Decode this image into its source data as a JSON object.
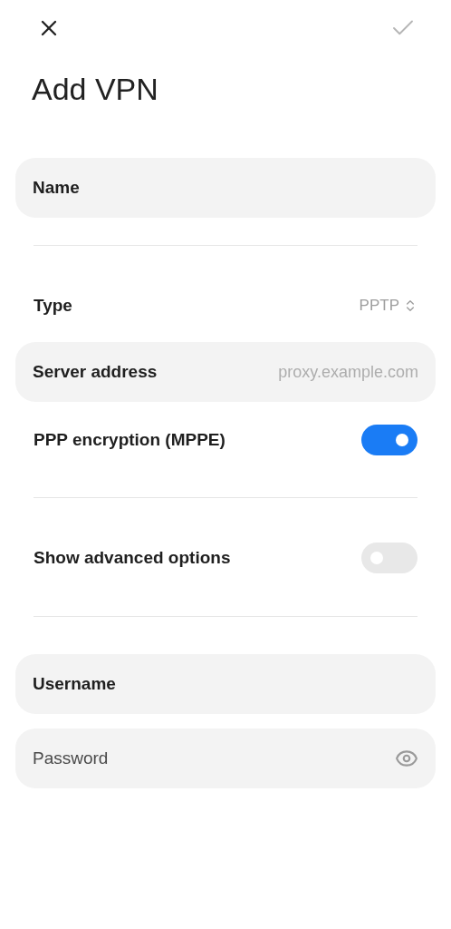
{
  "header": {
    "title": "Add VPN"
  },
  "name_field": {
    "label": "Name"
  },
  "type": {
    "label": "Type",
    "value": "PPTP"
  },
  "server_field": {
    "label": "Server address",
    "placeholder": "proxy.example.com"
  },
  "encryption": {
    "label": "PPP encryption (MPPE)",
    "on": true
  },
  "advanced": {
    "label": "Show advanced options",
    "on": false
  },
  "username_field": {
    "label": "Username"
  },
  "password_field": {
    "placeholder": "Password"
  }
}
